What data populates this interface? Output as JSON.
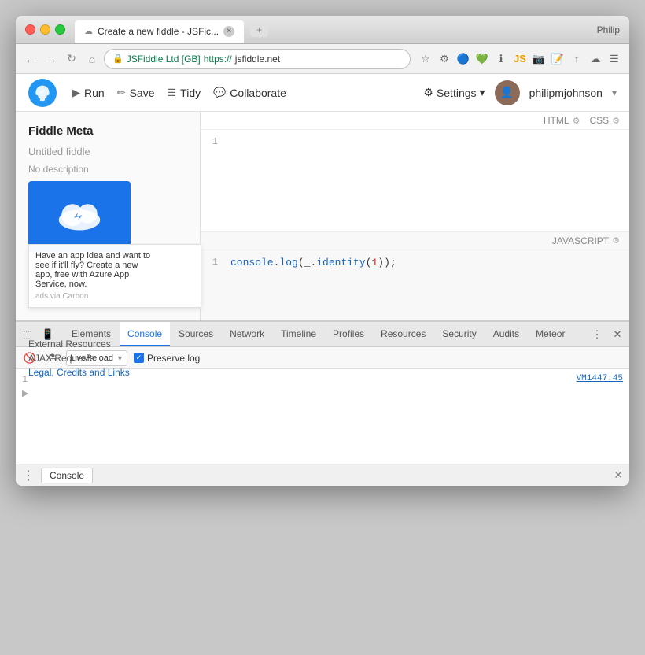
{
  "window": {
    "title": "Create a new fiddle - JSFic...",
    "user": "Philip"
  },
  "browser": {
    "url_secure": "JSFiddle Ltd [GB]",
    "url_protocol": "https://",
    "url_domain": "jsfiddle.net",
    "back": "←",
    "forward": "→",
    "reload": "↻",
    "home": "⌂"
  },
  "app": {
    "run_label": "Run",
    "save_label": "Save",
    "tidy_label": "Tidy",
    "collaborate_label": "Collaborate",
    "settings_label": "Settings",
    "username": "philipmjohnson"
  },
  "sidebar": {
    "title": "Fiddle Meta",
    "subtitle": "Untitled fiddle",
    "no_description": "No description",
    "external_resources": "External Resources",
    "ajax_requests": "AJAX Requests",
    "legal_credits": "Legal, Credits and Links"
  },
  "ad": {
    "line1": "Have an app idea and want to",
    "line2": "see if it'll fly? Create a new",
    "line3": "app, free with Azure App",
    "line4": "Service, now.",
    "via": "ads via Carbon"
  },
  "editor": {
    "html_label": "HTML",
    "css_label": "CSS",
    "javascript_label": "JAVASCRIPT",
    "line1_num": "1",
    "code": "console.log(_.identity(1));"
  },
  "devtools": {
    "tabs": [
      "Elements",
      "Console",
      "Sources",
      "Network",
      "Timeline",
      "Profiles",
      "Resources",
      "Security",
      "Audits",
      "Meteor"
    ],
    "active_tab": "Console"
  },
  "console": {
    "filter_value": "LiveReload",
    "preserve_log": "Preserve log",
    "line_num": "1",
    "link_text": "VM1447:45"
  },
  "bottom": {
    "tab_label": "Console"
  }
}
